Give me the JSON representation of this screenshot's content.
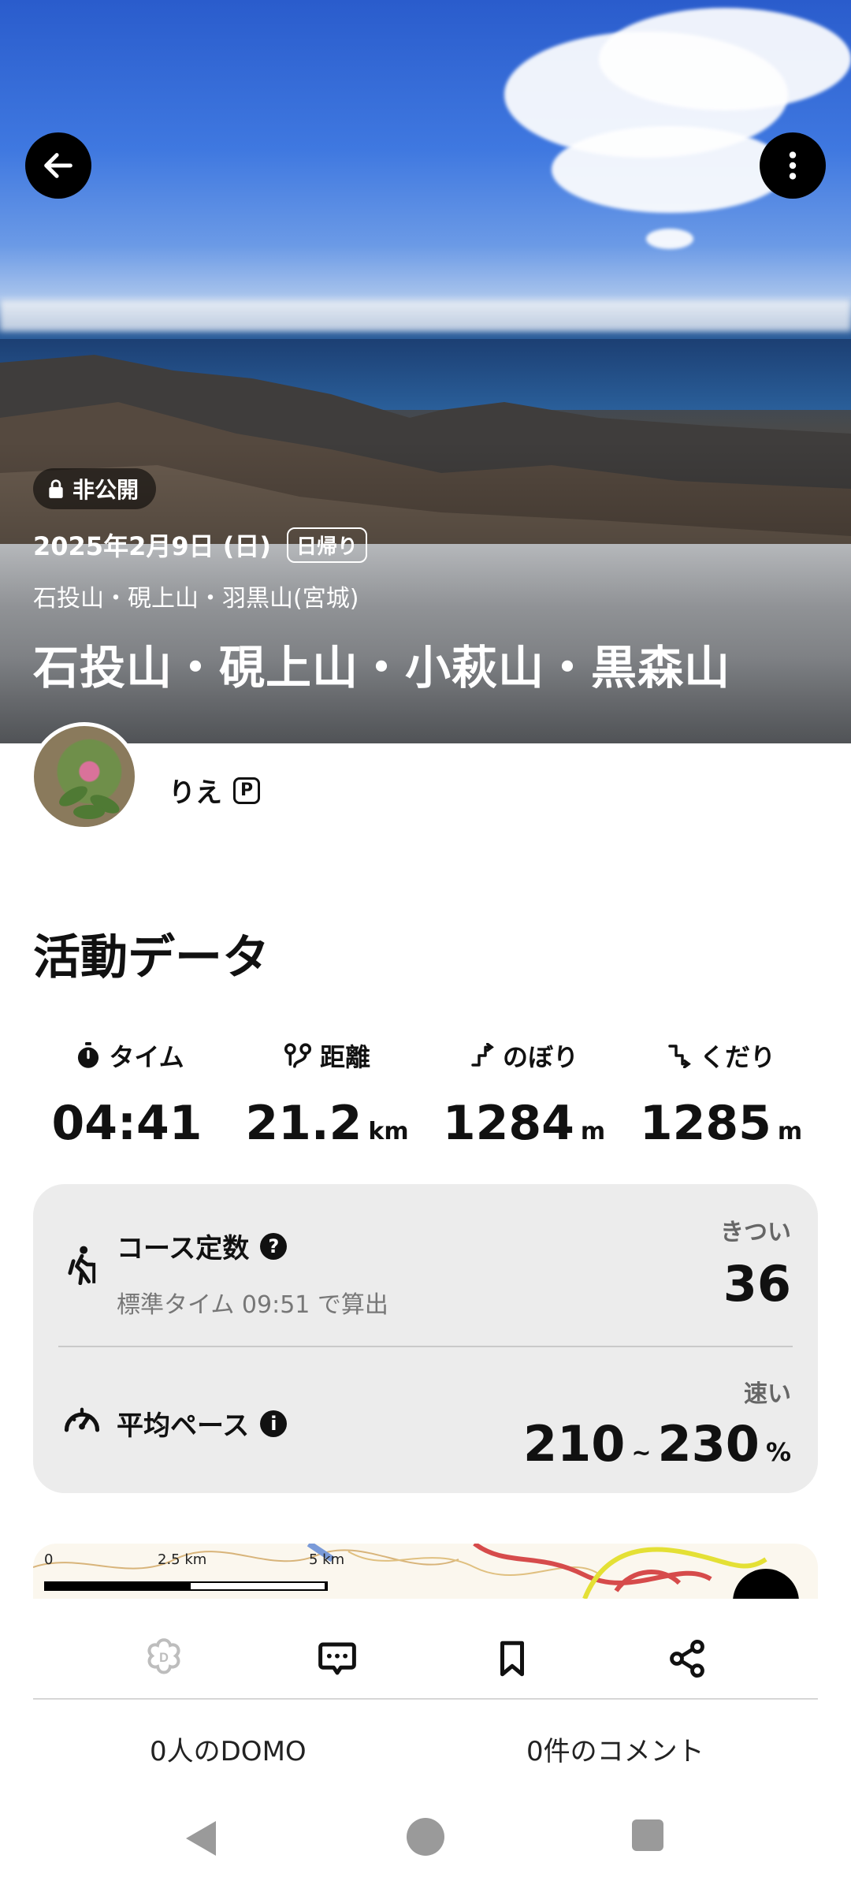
{
  "header": {
    "privacy_label": "非公開",
    "date": "2025年2月9日 (日)",
    "trip_type": "日帰り",
    "area": "石投山・硯上山・羽黒山(宮城)",
    "title": "石投山・硯上山・小萩山・黒森山"
  },
  "user": {
    "name": "りえ",
    "premium_badge": "P"
  },
  "activity": {
    "section_title": "活動データ",
    "stats": [
      {
        "label": "タイム",
        "value": "04:41",
        "unit": "",
        "icon": "stopwatch-icon"
      },
      {
        "label": "距離",
        "value": "21.2",
        "unit": "km",
        "icon": "route-icon"
      },
      {
        "label": "のぼり",
        "value": "1284",
        "unit": "m",
        "icon": "ascent-icon"
      },
      {
        "label": "くだり",
        "value": "1285",
        "unit": "m",
        "icon": "descent-icon"
      }
    ],
    "course": {
      "label": "コース定数",
      "help": "?",
      "sub": "標準タイム 09:51 で算出",
      "rating": "きつい",
      "value": "36"
    },
    "pace": {
      "label": "平均ペース",
      "info": "i",
      "rating": "速い",
      "min": "210",
      "separator": "~",
      "max": "230",
      "unit": "%"
    }
  },
  "map": {
    "scale_labels": [
      "0",
      "2.5 km",
      "5 km"
    ]
  },
  "footer": {
    "domo_count": "0人のDOMO",
    "comment_count": "0件のコメント"
  },
  "colors": {
    "accent": "#000000",
    "card_bg": "#ececec",
    "muted": "#777777"
  }
}
